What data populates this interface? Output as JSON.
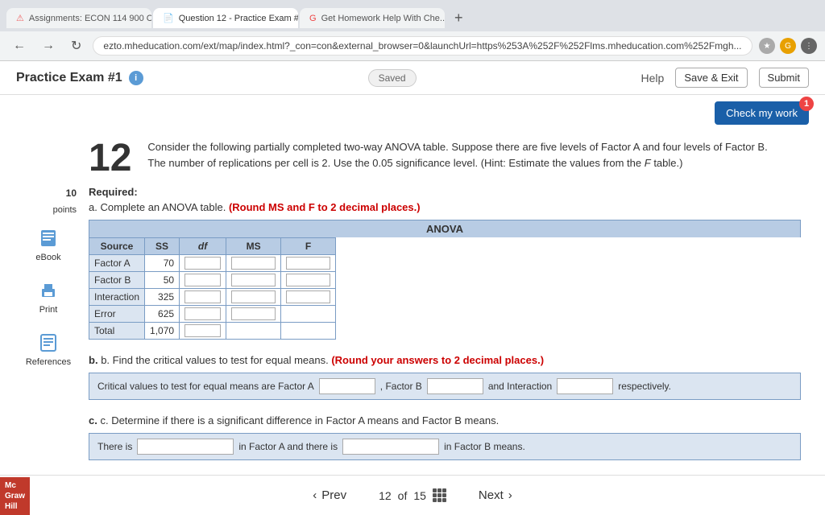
{
  "browser": {
    "tabs": [
      {
        "label": "Assignments: ECON 114 900 C...",
        "active": false,
        "favicon": "A"
      },
      {
        "label": "Question 12 - Practice Exam #...",
        "active": true,
        "favicon": "Q"
      },
      {
        "label": "Get Homework Help With Che...",
        "active": false,
        "favicon": "G"
      }
    ],
    "address": "ezto.mheducation.com/ext/map/index.html?_con=con&external_browser=0&launchUrl=https%253A%252F%252Flms.mheducation.com%252Fmgh...",
    "new_tab_label": "+"
  },
  "header": {
    "exam_title": "Practice Exam #1",
    "info_icon": "i",
    "saved_label": "Saved",
    "help_label": "Help",
    "save_exit_label": "Save & Exit",
    "submit_label": "Submit"
  },
  "check_work": {
    "button_label": "Check my work",
    "badge_count": "1"
  },
  "sidebar": {
    "items": [
      {
        "label": "eBook",
        "icon": "book"
      },
      {
        "label": "Print",
        "icon": "print"
      },
      {
        "label": "References",
        "icon": "ref"
      }
    ]
  },
  "question": {
    "number": "12",
    "points": "10",
    "points_label": "points",
    "text": "Consider the following partially completed two-way ANOVA table. Suppose there are five levels of Factor A and four levels of Factor B.\nThe number of replications per cell is 2. Use the 0.05 significance level. (Hint: Estimate the values from the F table.)",
    "required_label": "Required:",
    "part_a_label": "a. Complete an ANOVA table.",
    "part_a_highlight": "(Round MS and F to 2 decimal places.)",
    "anova_title": "ANOVA",
    "anova_headers": [
      "Source",
      "SS",
      "df",
      "MS",
      "F"
    ],
    "anova_rows": [
      {
        "source": "Factor A",
        "ss": "70",
        "df": "",
        "ms": "",
        "f": ""
      },
      {
        "source": "Factor B",
        "ss": "50",
        "df": "",
        "ms": "",
        "f": ""
      },
      {
        "source": "Interaction",
        "ss": "325",
        "df": "",
        "ms": "",
        "f": ""
      },
      {
        "source": "Error",
        "ss": "625",
        "df": "",
        "ms": "",
        "f": ""
      },
      {
        "source": "Total",
        "ss": "1,070",
        "df": "",
        "ms": "",
        "f": ""
      }
    ],
    "part_b_label": "b. Find the critical values to test for equal means.",
    "part_b_highlight": "(Round your answers to 2 decimal places.)",
    "cv_prefix": "Critical values to test for equal means are Factor A",
    "cv_factorb_label": ", Factor B",
    "cv_interaction_label": "and Interaction",
    "cv_suffix": "respectively.",
    "part_c_label": "c. Determine if there is a significant difference in Factor A means and Factor B means.",
    "sig_prefix": "There is",
    "sig_factora_label": "in Factor A and there is",
    "sig_factorb_label": "in Factor B means."
  },
  "footer": {
    "prev_label": "Prev",
    "next_label": "Next",
    "current_page": "12",
    "total_pages": "15",
    "of_label": "of"
  },
  "logo": {
    "line1": "Mc",
    "line2": "Graw",
    "line3": "Hill"
  }
}
